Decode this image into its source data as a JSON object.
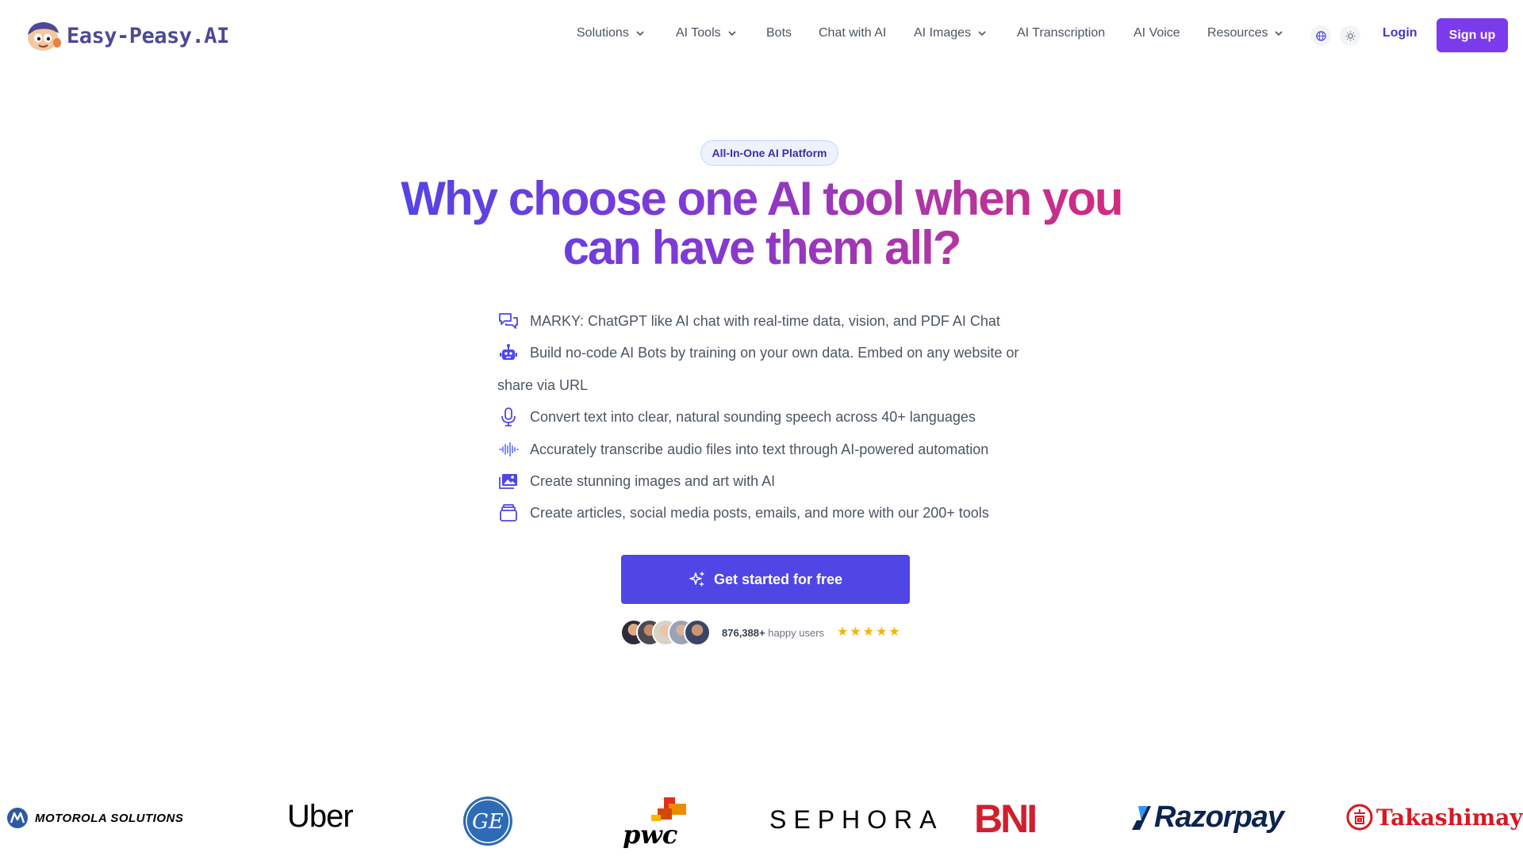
{
  "header": {
    "logo_text": "Easy-Peasy.AI",
    "nav": [
      {
        "label": "Solutions",
        "dropdown": true
      },
      {
        "label": "AI Tools",
        "dropdown": true
      },
      {
        "label": "Bots",
        "dropdown": false
      },
      {
        "label": "Chat with AI",
        "dropdown": false
      },
      {
        "label": "AI Images",
        "dropdown": true
      },
      {
        "label": "AI Transcription",
        "dropdown": false
      },
      {
        "label": "AI Voice",
        "dropdown": false
      },
      {
        "label": "Resources",
        "dropdown": true
      }
    ],
    "language_icon": "globe-icon",
    "theme_icon": "sun-icon",
    "login_label": "Login",
    "signup_label": "Sign up"
  },
  "hero": {
    "badge": "All-In-One AI Platform",
    "headline_line1": "Why choose one AI tool when you",
    "headline_line2": "can have them all?",
    "features": [
      {
        "icon": "chat-bubbles-icon",
        "text": "MARKY: ChatGPT like AI chat with real-time data, vision, and PDF AI Chat"
      },
      {
        "icon": "robot-icon",
        "text": "Build no-code AI Bots by training on your own data. Embed on any website or share via URL"
      },
      {
        "icon": "microphone-icon",
        "text": "Convert text into clear, natural sounding speech across 40+ languages"
      },
      {
        "icon": "waveform-icon",
        "text": "Accurately transcribe audio files into text through AI-powered automation"
      },
      {
        "icon": "images-icon",
        "text": "Create stunning images and art with AI"
      },
      {
        "icon": "stack-icon",
        "text": "Create articles, social media posts, emails, and more with our 200+ tools"
      }
    ],
    "cta_label": "Get started for free",
    "users_count": "876,388+",
    "users_label": "happy users",
    "rating_stars": 5
  },
  "brands": [
    "MOTOROLA SOLUTIONS",
    "Uber",
    "GE",
    "pwc",
    "SEPHORA",
    "BNI",
    "Razorpay",
    "Takashimaya"
  ],
  "colors": {
    "accent": "#4f46e5",
    "signup": "#7c3aed",
    "gradient_start": "#4f46e5",
    "gradient_end": "#db2777",
    "star": "#f5b301"
  }
}
